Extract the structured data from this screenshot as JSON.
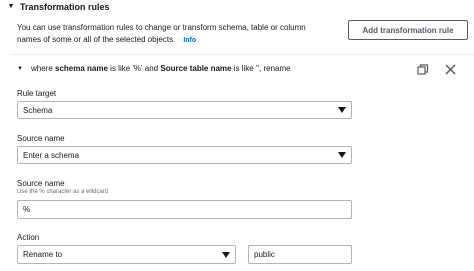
{
  "section": {
    "title": "Transformation rules"
  },
  "description": {
    "text": "You can use transformation rules to change or transform schema, table or column names of some or all of the selected objects.",
    "info_label": "Info"
  },
  "add_button_label": "Add transformation rule",
  "rule": {
    "summary_prefix": "where ",
    "summary_field1": "schema name",
    "summary_mid1": " is like '%' and ",
    "summary_field2": "Source table name",
    "summary_suffix": " is like '', rename"
  },
  "form": {
    "rule_target": {
      "label": "Rule target",
      "value": "Schema"
    },
    "source_name_select": {
      "label": "Source name",
      "placeholder": "Enter a schema"
    },
    "source_name_input": {
      "label": "Source name",
      "hint": "Use the % character as a wildcard",
      "value": "%"
    },
    "action": {
      "label": "Action",
      "value": "Rename to",
      "rename_value": "public"
    }
  },
  "icons": {
    "section_caret": "caret-down-icon",
    "rule_caret": "caret-down-icon",
    "copy": "copy-icon",
    "close": "close-icon"
  }
}
